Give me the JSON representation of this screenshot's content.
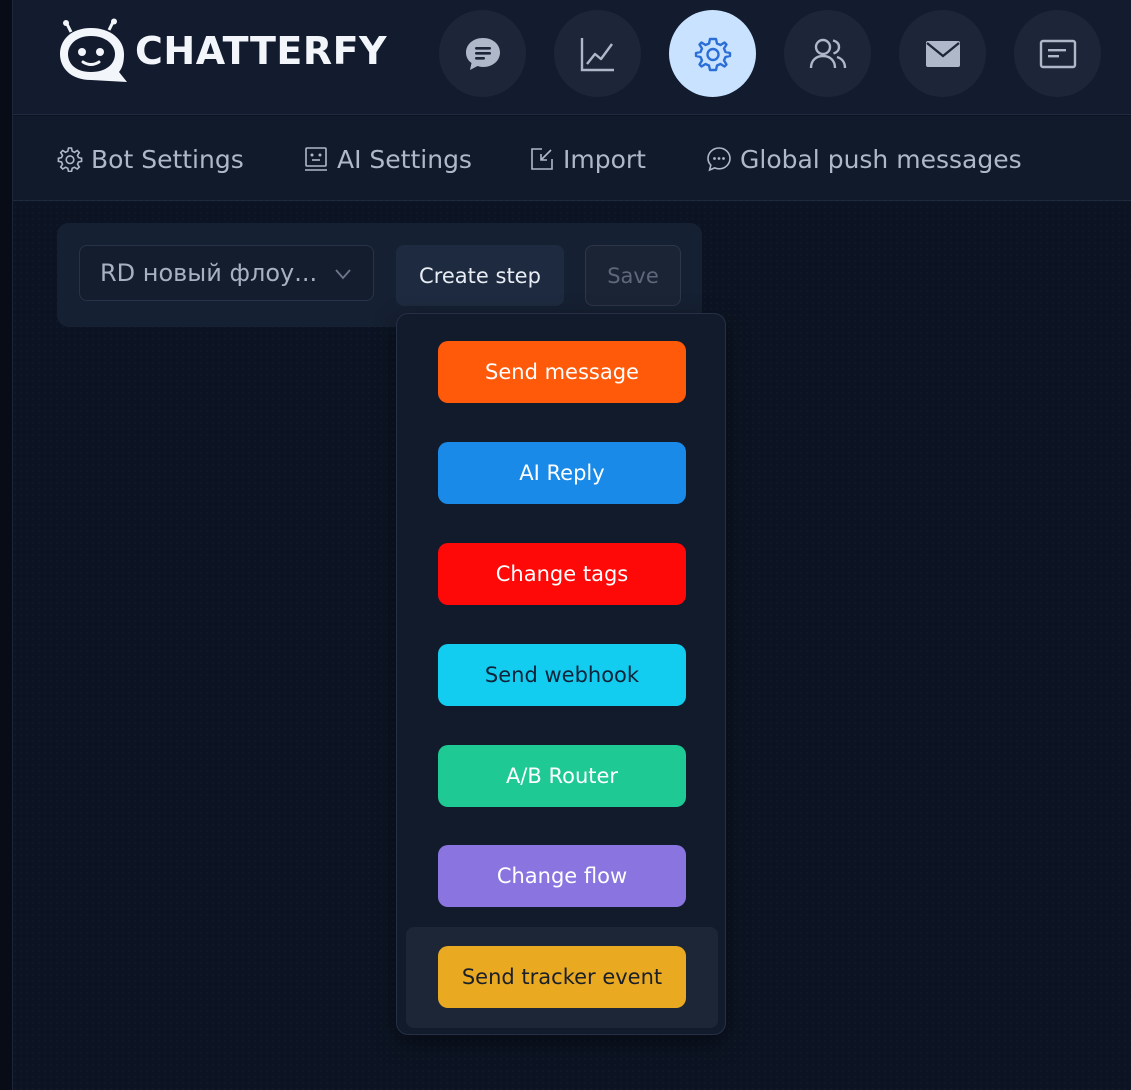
{
  "brand": {
    "name": "CHATTERFY"
  },
  "top_nav": [
    {
      "icon": "chat-bubble-icon",
      "active": false
    },
    {
      "icon": "chart-line-icon",
      "active": false
    },
    {
      "icon": "gear-icon",
      "active": true
    },
    {
      "icon": "users-icon",
      "active": false
    },
    {
      "icon": "envelope-icon",
      "active": false
    },
    {
      "icon": "card-icon",
      "active": false
    }
  ],
  "sub_nav": {
    "bot_settings": "Bot Settings",
    "ai_settings": "AI Settings",
    "import": "Import",
    "global_push": "Global push messages"
  },
  "toolbar": {
    "flow_select_value": "RD новый флоу...",
    "create_step_label": "Create step",
    "save_label": "Save"
  },
  "step_menu": {
    "send_message": "Send message",
    "ai_reply": "AI Reply",
    "change_tags": "Change tags",
    "send_webhook": "Send webhook",
    "ab_router": "A/B Router",
    "change_flow": "Change flow",
    "send_tracker_event": "Send tracker event"
  },
  "colors": {
    "background": "#0c1423",
    "active_nav": "#c9e2ff",
    "send_message": "#ff5a0a",
    "ai_reply": "#1a8ae8",
    "change_tags": "#ff0808",
    "send_webhook": "#12cdef",
    "ab_router": "#1ec994",
    "change_flow": "#8a75e0",
    "send_tracker_event": "#e9aa21"
  }
}
